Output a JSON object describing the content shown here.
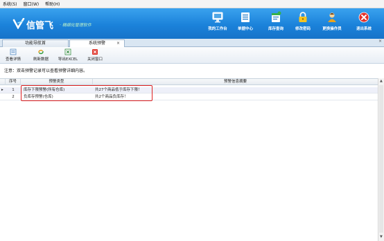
{
  "menu": [
    "系统(S)",
    "窗口(W)",
    "帮助(H)"
  ],
  "brand": {
    "name": "信管飞",
    "dot": "·",
    "slogan": "精细化管理软件"
  },
  "topnav": [
    {
      "label": "我的工作台",
      "icon": "monitor-icon"
    },
    {
      "label": "单据中心",
      "icon": "document-list-icon"
    },
    {
      "label": "库存查询",
      "icon": "inventory-search-icon"
    },
    {
      "label": "修改密码",
      "icon": "lock-icon"
    },
    {
      "label": "更换操作员",
      "icon": "user-switch-icon"
    },
    {
      "label": "退出系统",
      "icon": "exit-icon"
    }
  ],
  "tabs": [
    {
      "label": "功能导航首",
      "active": false
    },
    {
      "label": "系统预警",
      "active": true,
      "close": "×"
    }
  ],
  "close_all": "×",
  "toolbar": [
    {
      "label": "查看详情",
      "icon": "view-details-icon"
    },
    {
      "label": "刷新数据",
      "icon": "refresh-icon"
    },
    {
      "label": "导出EXCEL",
      "icon": "excel-icon"
    },
    {
      "label": "关闭窗口",
      "icon": "close-window-icon"
    }
  ],
  "notice": "注意：双击预警记录可以查看预警详细内容。",
  "grid": {
    "columns": [
      "序号",
      "预警类型",
      "预警信息摘要"
    ],
    "rows": [
      {
        "indicator": "▸",
        "no": "1",
        "type": "库存下限预警(所有仓库)",
        "summary": "共27个商品低于库存下限！"
      },
      {
        "indicator": "",
        "no": "2",
        "type": "负库存预警(仓库)",
        "summary": "共2个商品负库存！"
      }
    ]
  },
  "scroll": {
    "up": "▲",
    "down": "▼"
  }
}
